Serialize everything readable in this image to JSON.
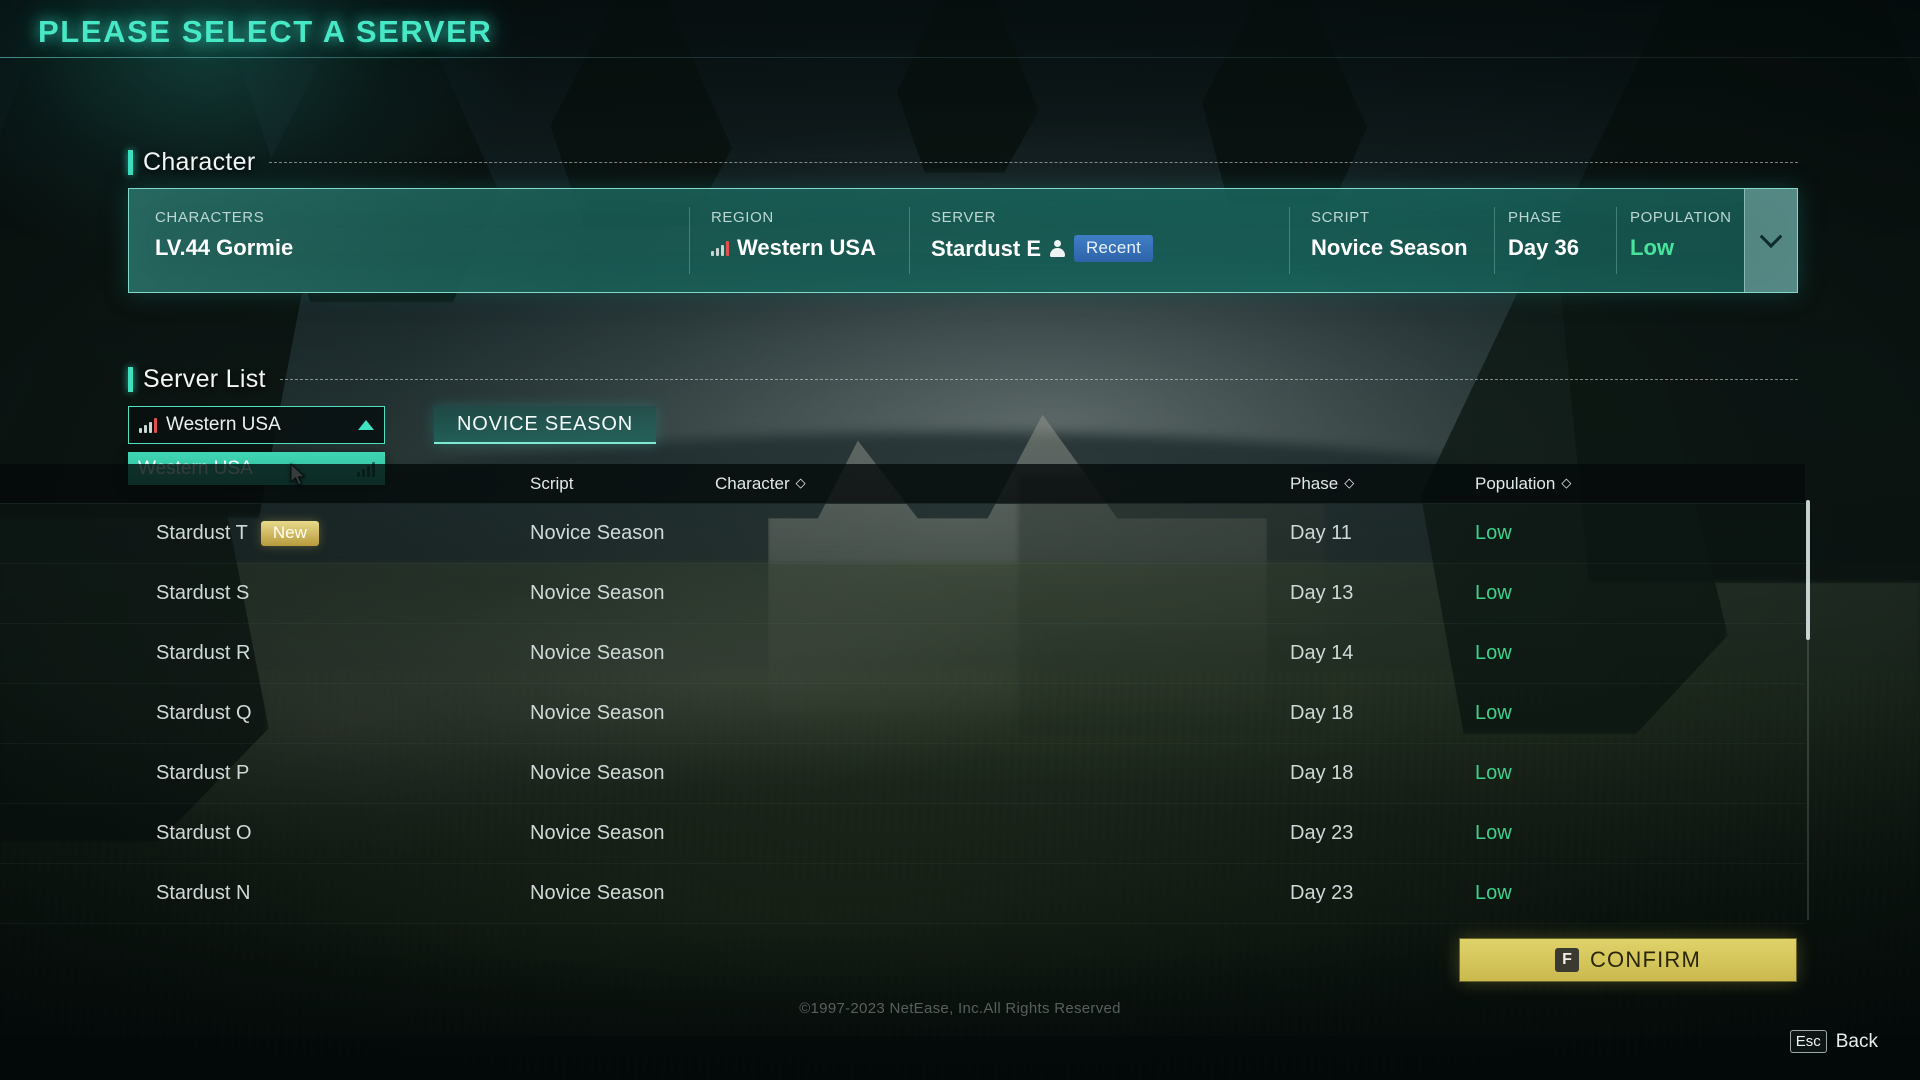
{
  "title": "PLEASE SELECT A SERVER",
  "sections": {
    "character": "Character",
    "server_list": "Server List"
  },
  "character_card": {
    "columns": {
      "characters": "CHARACTERS",
      "region": "REGION",
      "server": "SERVER",
      "script": "SCRIPT",
      "phase": "PHASE",
      "population": "POPULATION"
    },
    "values": {
      "characters": "LV.44 Gormie",
      "region": "Western USA",
      "server": "Stardust E",
      "server_badge": "Recent",
      "script": "Novice Season",
      "phase": "Day 36",
      "population": "Low"
    },
    "expand_icon": "chevron-down-icon"
  },
  "controls": {
    "region_selected": "Western USA",
    "region_dropdown_open": true,
    "region_options": [
      "Western USA"
    ],
    "season_tab": "NOVICE SEASON"
  },
  "table": {
    "headers": {
      "server": "",
      "script": "Script",
      "character": "Character",
      "phase": "Phase",
      "population": "Population"
    },
    "sortable": [
      "character",
      "phase",
      "population"
    ],
    "rows": [
      {
        "server": "Stardust T",
        "badge": "New",
        "script": "Novice Season",
        "character": "",
        "phase": "Day 11",
        "population": "Low"
      },
      {
        "server": "Stardust S",
        "badge": "",
        "script": "Novice Season",
        "character": "",
        "phase": "Day 13",
        "population": "Low"
      },
      {
        "server": "Stardust R",
        "badge": "",
        "script": "Novice Season",
        "character": "",
        "phase": "Day 14",
        "population": "Low"
      },
      {
        "server": "Stardust Q",
        "badge": "",
        "script": "Novice Season",
        "character": "",
        "phase": "Day 18",
        "population": "Low"
      },
      {
        "server": "Stardust P",
        "badge": "",
        "script": "Novice Season",
        "character": "",
        "phase": "Day 18",
        "population": "Low"
      },
      {
        "server": "Stardust O",
        "badge": "",
        "script": "Novice Season",
        "character": "",
        "phase": "Day 23",
        "population": "Low"
      },
      {
        "server": "Stardust N",
        "badge": "",
        "script": "Novice Season",
        "character": "",
        "phase": "Day 23",
        "population": "Low"
      }
    ]
  },
  "footer": {
    "confirm_key": "F",
    "confirm_label": "CONFIRM",
    "copyright": "©1997-2023 NetEase, Inc.All Rights Reserved",
    "back_key": "Esc",
    "back_label": "Back"
  },
  "colors": {
    "accent_cyan": "#46e8c6",
    "card_teal": "#175c54",
    "population_green": "#3fd18c",
    "badge_new_gold": "#d6c75c",
    "badge_recent_blue": "#3f7fc8",
    "confirm_yellow": "#d6c75c"
  }
}
